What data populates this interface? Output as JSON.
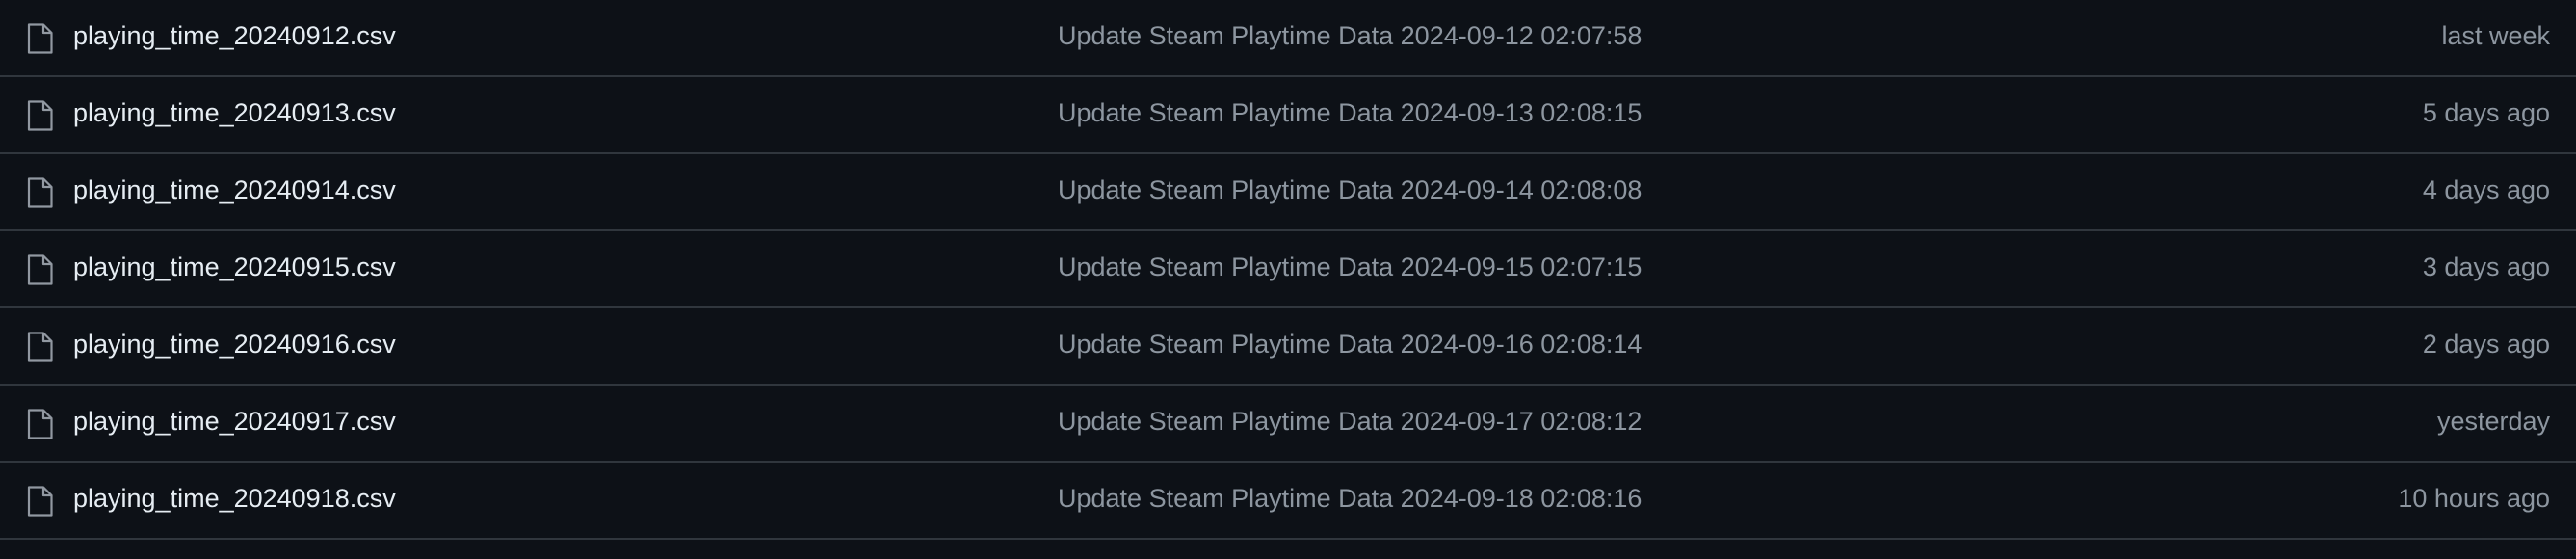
{
  "files": [
    {
      "name": "playing_time_20240912.csv",
      "commit_message": "Update Steam Playtime Data 2024-09-12 02:07:58",
      "age": "last week",
      "icon": "file-icon"
    },
    {
      "name": "playing_time_20240913.csv",
      "commit_message": "Update Steam Playtime Data 2024-09-13 02:08:15",
      "age": "5 days ago",
      "icon": "file-icon"
    },
    {
      "name": "playing_time_20240914.csv",
      "commit_message": "Update Steam Playtime Data 2024-09-14 02:08:08",
      "age": "4 days ago",
      "icon": "file-icon"
    },
    {
      "name": "playing_time_20240915.csv",
      "commit_message": "Update Steam Playtime Data 2024-09-15 02:07:15",
      "age": "3 days ago",
      "icon": "file-icon"
    },
    {
      "name": "playing_time_20240916.csv",
      "commit_message": "Update Steam Playtime Data 2024-09-16 02:08:14",
      "age": "2 days ago",
      "icon": "file-icon"
    },
    {
      "name": "playing_time_20240917.csv",
      "commit_message": "Update Steam Playtime Data 2024-09-17 02:08:12",
      "age": "yesterday",
      "icon": "file-icon"
    },
    {
      "name": "playing_time_20240918.csv",
      "commit_message": "Update Steam Playtime Data 2024-09-18 02:08:16",
      "age": "10 hours ago",
      "icon": "file-icon"
    }
  ],
  "colors": {
    "background": "#0d1117",
    "divider": "#30363d",
    "file_name": "#e6edf3",
    "muted_text": "#8d96a0",
    "icon": "#9198a1"
  }
}
